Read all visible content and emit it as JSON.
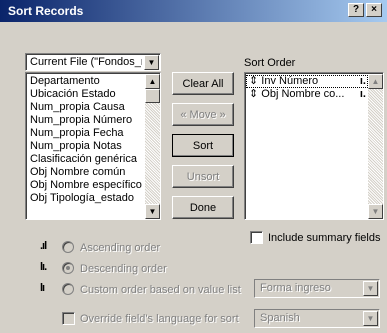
{
  "window": {
    "title": "Sort Records",
    "help_label": "?",
    "close_label": "×"
  },
  "source_dropdown": {
    "value": "Current File (\"Fondos_r"
  },
  "field_list": [
    "Departamento",
    "Ubicación Estado",
    "Num_propia Causa",
    "Num_propia Número",
    "Num_propia Fecha",
    "Num_propia Notas",
    "Clasificación genérica",
    "Obj Nombre común",
    "Obj Nombre específico",
    "Obj Tipología_estado"
  ],
  "buttons": {
    "clear_all": "Clear All",
    "move": "« Move »",
    "sort": "Sort",
    "unsort": "Unsort",
    "done": "Done"
  },
  "sort_order": {
    "label": "Sort Order",
    "items": [
      {
        "marker": "⇕",
        "label": "Inv Número"
      },
      {
        "marker": "⇕",
        "label": "Obj Nombre co..."
      }
    ]
  },
  "include_summary": {
    "label": "Include summary fields",
    "checked": false
  },
  "order_options": [
    {
      "label": "Ascending order",
      "selected": false
    },
    {
      "label": "Descending order",
      "selected": true
    },
    {
      "label": "Custom order based on value list",
      "selected": false
    }
  ],
  "value_list_dropdown": {
    "value": "Forma ingreso"
  },
  "override_language": {
    "label": "Override field's language for sort",
    "checked": false
  },
  "language_dropdown": {
    "value": "Spanish"
  },
  "icons": {
    "ascending": "ascending-order-icon",
    "descending": "descending-order-icon",
    "custom": "custom-order-icon"
  }
}
